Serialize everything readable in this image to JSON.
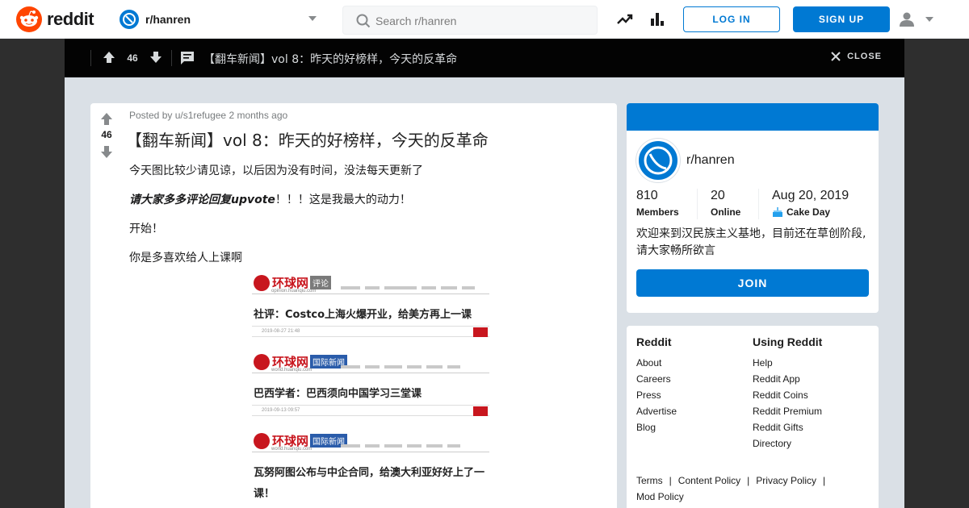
{
  "header": {
    "logo_text": "reddit",
    "subreddit": "r/hanren",
    "search_placeholder": "Search r/hanren",
    "login_label": "LOG IN",
    "signup_label": "SIGN UP"
  },
  "topbar": {
    "vote_count": "46",
    "title": "【翻车新闻】vol 8：昨天的好榜样，今天的反革命",
    "close_label": "CLOSE"
  },
  "post": {
    "posted_by_prefix": "Posted by",
    "author": "u/s1refugee",
    "time": "2 months ago",
    "vote_count": "46",
    "title": "【翻车新闻】vol 8：昨天的好榜样，今天的反革命",
    "para1": "今天图比较少请见谅，以后因为没有时间，没法每天更新了",
    "para2_em": "请大家多多评论回复upvote",
    "para2_rest": "！！！这是我最大的动力！",
    "para3": "开始！",
    "para4": "你是多喜欢给人上课啊",
    "embed": [
      {
        "site": "环球网",
        "tag": "评论",
        "tag_color": "#7a7a7a",
        "url": "opinion.huanqiu.com",
        "headline": "社评：Costco上海火爆开业，给美方再上一课",
        "date": "2019-08-27 21:48"
      },
      {
        "site": "环球网",
        "tag": "国际新闻",
        "tag_color": "#2a5caa",
        "url": "world.huanqiu.com",
        "headline": "巴西学者：巴西须向中国学习三堂课",
        "date": "2019-09-13 09:57"
      },
      {
        "site": "环球网",
        "tag": "国际新闻",
        "tag_color": "#2a5caa",
        "url": "world.huanqiu.com",
        "headline": "瓦努阿图公布与中企合同，给澳大利亚好好上了一课！",
        "date": ""
      }
    ]
  },
  "sidebar": {
    "name": "r/hanren",
    "members_value": "810",
    "members_label": "Members",
    "online_value": "20",
    "online_label": "Online",
    "cake_value": "Aug 20, 2019",
    "cake_label": "Cake Day",
    "description": "欢迎来到汉民族主义基地，目前还在草创阶段,请大家畅所欲言",
    "join_label": "JOIN"
  },
  "links": {
    "col1_head": "Reddit",
    "col1": [
      "About",
      "Careers",
      "Press",
      "Advertise",
      "Blog"
    ],
    "col2_head": "Using Reddit",
    "col2": [
      "Help",
      "Reddit App",
      "Reddit Coins",
      "Reddit Premium",
      "Reddit Gifts",
      "Directory"
    ],
    "bottom": [
      "Terms",
      "Content Policy",
      "Privacy Policy",
      "Mod Policy"
    ]
  },
  "colors": {
    "brand": "#ff4500",
    "accent": "#0079d3",
    "dark_bar": "#030303",
    "bg": "#dae0e6"
  }
}
